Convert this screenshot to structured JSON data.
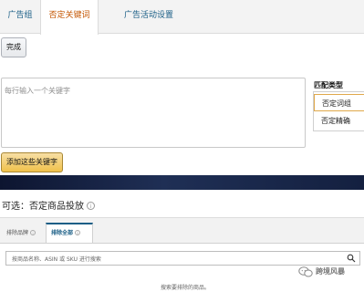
{
  "tabs": [
    {
      "label": "广告组",
      "active": false
    },
    {
      "label": "否定关键词",
      "active": true
    },
    {
      "label": "广告活动设置",
      "active": false
    }
  ],
  "done_button": "完成",
  "keyword_textarea": {
    "placeholder": "每行输入一个关键字",
    "value": ""
  },
  "match_type": {
    "title": "匹配类型",
    "options": [
      "否定词组",
      "否定精确"
    ],
    "selected": "否定词组"
  },
  "add_button": "添加这些关键字",
  "optional_section": {
    "title": "可选：否定商品投放"
  },
  "product_tabs": [
    {
      "label": "排除品牌",
      "active": false
    },
    {
      "label": "排除全部",
      "active": true
    }
  ],
  "product_search": {
    "placeholder": "按商品名称、ASIN 或 SKU 进行搜索"
  },
  "empty_message": "搜索要排除的商品。",
  "watermark": {
    "text": "跨境风暴"
  },
  "colors": {
    "active_tab": "#c45500",
    "link": "#1a5e86",
    "primary_button": "#f0c14b"
  }
}
